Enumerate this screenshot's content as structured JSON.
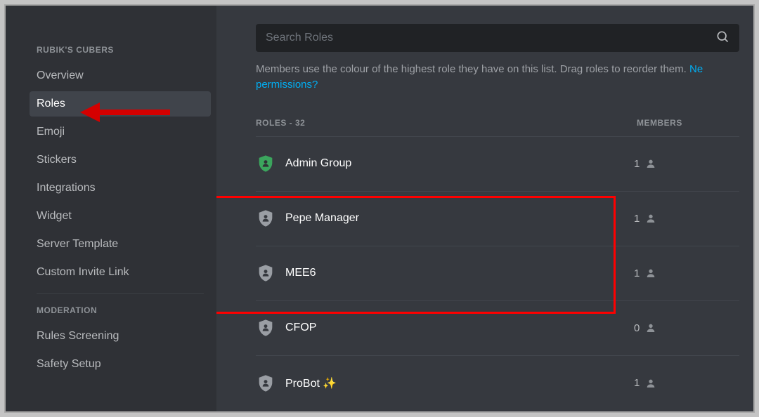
{
  "sidebar": {
    "section1_header": "RUBIK'S CUBERS",
    "items": [
      {
        "label": "Overview"
      },
      {
        "label": "Roles",
        "active": true
      },
      {
        "label": "Emoji"
      },
      {
        "label": "Stickers"
      },
      {
        "label": "Integrations"
      },
      {
        "label": "Widget"
      },
      {
        "label": "Server Template"
      },
      {
        "label": "Custom Invite Link"
      }
    ],
    "section2_header": "MODERATION",
    "items2": [
      {
        "label": "Rules Screening"
      },
      {
        "label": "Safety Setup"
      }
    ]
  },
  "search": {
    "placeholder": "Search Roles"
  },
  "hint": {
    "text": "Members use the colour of the highest role they have on this list. Drag roles to reorder them. ",
    "link_truncated": "Ne",
    "link2": "permissions?"
  },
  "columns": {
    "roles": "ROLES - 32",
    "members": "MEMBERS"
  },
  "roles": [
    {
      "name": "Admin Group",
      "members": "1",
      "color": "#3ba55d"
    },
    {
      "name": "Pepe Manager",
      "members": "1",
      "color": "#9a9ea4"
    },
    {
      "name": "MEE6",
      "members": "1",
      "color": "#9a9ea4"
    },
    {
      "name": "CFOP",
      "members": "0",
      "color": "#9a9ea4"
    },
    {
      "name": "ProBot ✨",
      "members": "1",
      "color": "#9a9ea4"
    }
  ]
}
